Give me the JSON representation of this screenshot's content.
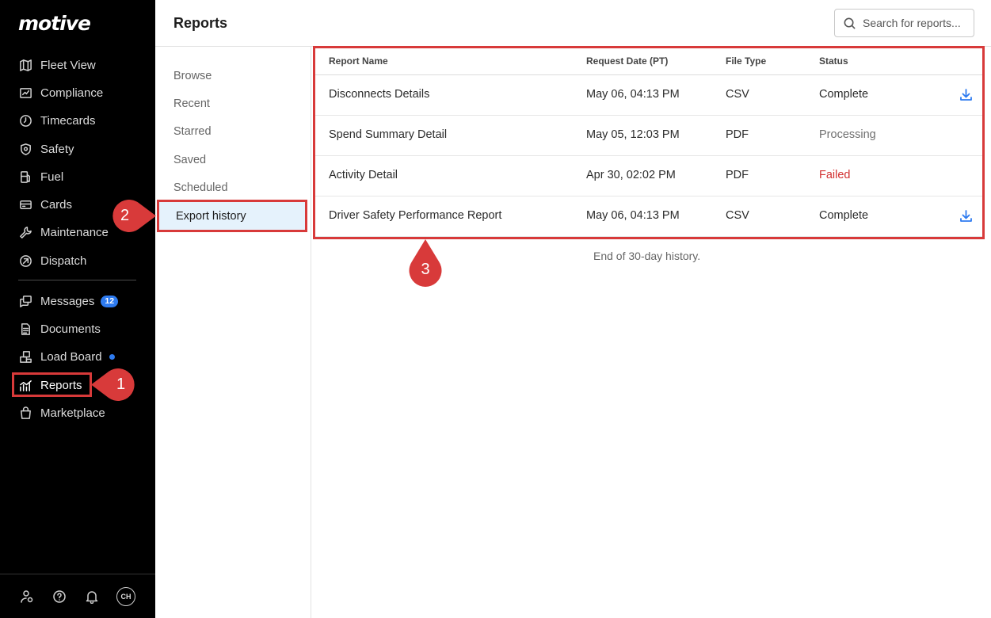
{
  "brand": {
    "logo_text": "motive"
  },
  "sidebar": {
    "items": [
      {
        "label": "Fleet View",
        "icon": "map-icon"
      },
      {
        "label": "Compliance",
        "icon": "compliance-icon"
      },
      {
        "label": "Timecards",
        "icon": "clock-icon"
      },
      {
        "label": "Safety",
        "icon": "shield-icon"
      },
      {
        "label": "Fuel",
        "icon": "fuel-icon"
      },
      {
        "label": "Cards",
        "icon": "card-icon"
      },
      {
        "label": "Maintenance",
        "icon": "wrench-icon"
      },
      {
        "label": "Dispatch",
        "icon": "dispatch-icon"
      },
      {
        "label": "Messages",
        "icon": "messages-icon",
        "badge": "12"
      },
      {
        "label": "Documents",
        "icon": "document-icon"
      },
      {
        "label": "Load Board",
        "icon": "load-board-icon"
      },
      {
        "label": "Reports",
        "icon": "reports-icon",
        "active": true
      },
      {
        "label": "Marketplace",
        "icon": "bag-icon"
      }
    ],
    "bottom": {
      "avatar_initials": "CH"
    }
  },
  "header": {
    "title": "Reports",
    "search_placeholder": "Search for reports..."
  },
  "subnav": {
    "items": [
      "Browse",
      "Recent",
      "Starred",
      "Saved",
      "Scheduled",
      "Export history"
    ],
    "active": "Export history"
  },
  "table": {
    "columns": [
      "Report Name",
      "Request Date (PT)",
      "File Type",
      "Status"
    ],
    "rows": [
      {
        "name": "Disconnects Details",
        "date": "May 06, 04:13 PM",
        "type": "CSV",
        "status": "Complete",
        "download": true
      },
      {
        "name": "Spend Summary Detail",
        "date": "May 05, 12:03 PM",
        "type": "PDF",
        "status": "Processing",
        "download": false
      },
      {
        "name": "Activity Detail",
        "date": "Apr 30, 02:02 PM",
        "type": "PDF",
        "status": "Failed",
        "download": false
      },
      {
        "name": "Driver Safety Performance Report",
        "date": "May 06, 04:13 PM",
        "type": "CSV",
        "status": "Complete",
        "download": true
      }
    ],
    "end_note": "End of 30-day history."
  },
  "callouts": [
    "1",
    "2",
    "3"
  ],
  "colors": {
    "accent": "#2e7bf0",
    "callout": "#d83a3a",
    "failed": "#d22f2f",
    "active_bg": "#e5f2fc"
  }
}
